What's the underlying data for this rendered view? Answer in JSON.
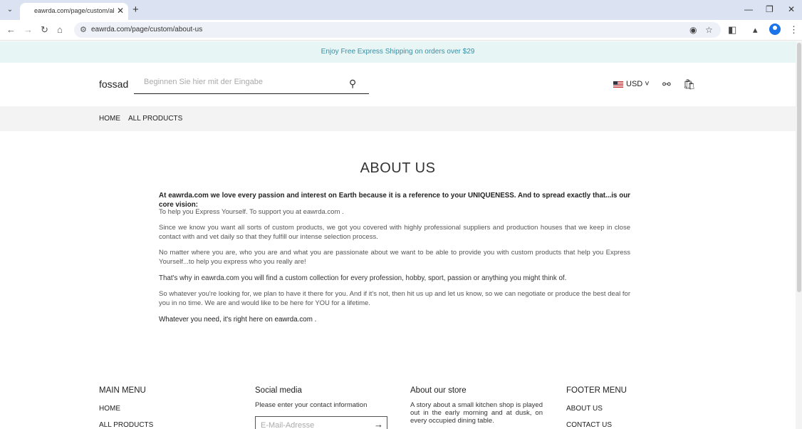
{
  "browser": {
    "tab_title": "eawrda.com/page/custom/abo",
    "url": "eawrda.com/page/custom/about-us"
  },
  "announcement": "Enjoy Free Express Shipping on orders over $29",
  "header": {
    "logo": "fossad",
    "search_placeholder": "Beginnen Sie hier mit der Eingabe",
    "currency": "USD"
  },
  "nav": {
    "items": [
      "HOME",
      "ALL PRODUCTS"
    ]
  },
  "about": {
    "title": "ABOUT US",
    "paragraphs": [
      "At eawrda.com   we love every passion and interest on Earth because it is a reference to your UNIQUENESS.  And to spread exactly that...is  our core vision:",
      "To help you Express Yourself. To support you at eawrda.com  .",
      "Since we know you want all sorts of custom products, we got  you covered with highly professional suppliers and production houses that we keep in close contact with and vet daily so that they fulfill our intense selection process.",
      "No matter where you are, who you are and what you are passionate about we want to be able to provide you with custom products that help you Express Yourself...to help you express who you really are!",
      "That's why in eawrda.com   you will find a custom collection for every profession, hobby, sport, passion or anything you might think of.",
      "So whatever you're looking for, we plan to have it there for you. And if it's not, then hit us up and let us know, so we can negotiate or produce the best deal for you in no time. We are and would like to be here for YOU for a lifetime.",
      "Whatever you need, it's right here on eawrda.com  ."
    ]
  },
  "footer": {
    "main_menu": {
      "title": "MAIN MENU",
      "items": [
        "HOME",
        "ALL PRODUCTS"
      ]
    },
    "social": {
      "title": "Social media",
      "text": "Please enter your contact information",
      "email_placeholder": "E-Mail-Adresse"
    },
    "about_store": {
      "title": "About our store",
      "text": "A story about a small kitchen shop is played out in the early morning and at dusk, on every occupied dining table."
    },
    "footer_menu": {
      "title": "FOOTER MENU",
      "items": [
        "ABOUT US",
        "CONTACT US"
      ]
    }
  }
}
